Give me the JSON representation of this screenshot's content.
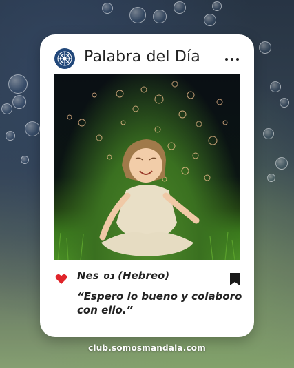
{
  "card": {
    "title": "Palabra del Día",
    "word": "Nes נס (Hebreo)",
    "quote": "“Espero lo bueno y colaboro con ello.”"
  },
  "footer": {
    "url": "club.somosmandala.com"
  },
  "colors": {
    "heart": "#e0242a",
    "logo_bg": "#21477a"
  },
  "icons": {
    "logo": "mandala-logo-icon",
    "menu": "more-dots-icon",
    "like": "heart-icon",
    "save": "bookmark-icon"
  }
}
